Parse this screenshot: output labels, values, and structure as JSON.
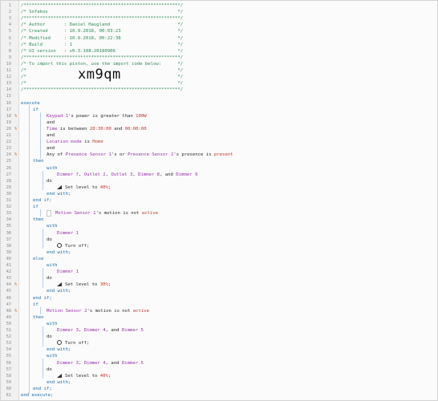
{
  "piston": {
    "import_code": "xm9qm",
    "header_comments": [
      "/**********************************************************/",
      "/* Sofakos                                                */",
      "/**********************************************************/",
      "/* Author       : Daniel Haugland                         */",
      "/* Created      : 10.9.2018, 00:03:23                     */",
      "/* Modified     : 10.9.2018, 00:22:38                     */",
      "/* Build        : 1                                       */",
      "/* UI version   : v0.3.108.20180906                       */",
      "/**********************************************************/",
      "/* To import this piston, use the import code below:      */",
      "/*                                                        */",
      "/*                                                        */",
      "/*                                                        */",
      "/**********************************************************/"
    ]
  },
  "code": {
    "execute": "execute",
    "end_execute": "end execute;",
    "if": "if",
    "then": "then",
    "else": "else",
    "end_if": "end if;",
    "with": "with",
    "do": "do",
    "end_with": "end with;",
    "and": "and",
    "or": "or",
    "conditions1": {
      "c1_dev": "Keypad 1",
      "c1_mid": "'s power is greater than",
      "c1_val": "100W",
      "c2_attr": "Time",
      "c2_mid": " is between ",
      "c2_v1": "20:30:00",
      "c2_and": " and ",
      "c2_v2": "00:00:00",
      "c3_attr": "Location mode",
      "c3_mid": " is ",
      "c3_val": "Home",
      "c4_pre": "Any of ",
      "c4_d1": "Presence Sensor 1",
      "c4_or": "'s or ",
      "c4_d2": "Presence Sensor 2",
      "c4_mid": "'s presence is ",
      "c4_val": "present"
    },
    "with1": {
      "d1": "Dimmer 7",
      "d2": "Outlet 2",
      "d3": "Outlet 3",
      "d4": "Dimmer 8",
      "d5": "Dimmer 9",
      "sep": ", ",
      "last_sep": ", and ",
      "action": "Set level to ",
      "val": "40%",
      "semi": ";"
    },
    "if2": {
      "dev": "Motion Sensor 1",
      "mid": "'s motion is not ",
      "val": "active",
      "then_dev": "Dimmer 1",
      "then_action": "Turn off;",
      "else_dev": "Dimmer 1",
      "else_action": "Set level to ",
      "else_val": "30%"
    },
    "if3": {
      "dev": "Motion Sensor 2",
      "mid": "'s motion is not ",
      "val": "active",
      "d1": "Dimmer 3",
      "d2": "Dimmer 4",
      "d3": "Dimmer 5",
      "action1": "Turn off;",
      "action2": "Set level to ",
      "val2": "40%"
    }
  },
  "line_numbers": [
    "1",
    "2",
    "3",
    "4",
    "5",
    "6",
    "7",
    "8",
    "9",
    "10",
    "11",
    "12",
    "13",
    "14",
    "15",
    "16",
    "17",
    "18",
    "19",
    "20",
    "21",
    "22",
    "23",
    "24",
    "25",
    "26",
    "27",
    "28",
    "29",
    "30",
    "31",
    "32",
    "33",
    "34",
    "35",
    "36",
    "37",
    "38",
    "39",
    "40",
    "41",
    "42",
    "43",
    "44",
    "45",
    "46",
    "47",
    "48",
    "49",
    "50",
    "51",
    "52",
    "53",
    "54",
    "55",
    "56",
    "57",
    "58",
    "59",
    "60",
    "61"
  ],
  "marker_glyph": "%",
  "colors": {
    "comment": "#2e8b57",
    "keyword": "#1a6fa8",
    "device": "#9b2fae",
    "value": "#c0392b"
  }
}
